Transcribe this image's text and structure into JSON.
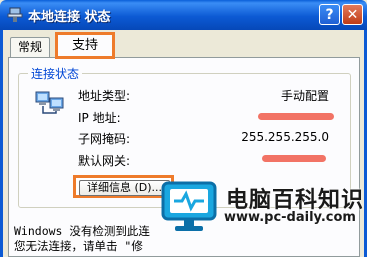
{
  "window": {
    "title": "本地连接 状态"
  },
  "controls": {
    "help_label": "?",
    "close_label": "✕"
  },
  "tabs": [
    {
      "label": "常规"
    },
    {
      "label": "支持"
    }
  ],
  "connection_status": {
    "group_title": "连接状态",
    "rows": [
      {
        "label": "地址类型:",
        "value": "手动配置"
      },
      {
        "label": "IP 地址:",
        "value": ""
      },
      {
        "label": "子网掩码:",
        "value": "255.255.255.0"
      },
      {
        "label": "默认网关:",
        "value": ""
      }
    ],
    "details_button": "详细信息 (D)..."
  },
  "note_lines": [
    "Windows 没有检测到此连",
    "您无法连接，请单击 \"修"
  ],
  "watermark": {
    "title": "电脑百科知识",
    "url": "www.pc-daily.com"
  },
  "colors": {
    "highlight_box": "#ee7b2b",
    "titlebar": "#0c5ad4",
    "group_title": "#0046d5"
  },
  "icons": [
    "network-connection-icon",
    "help-icon",
    "close-icon",
    "network-computers-icon",
    "monitor-logo-icon"
  ]
}
